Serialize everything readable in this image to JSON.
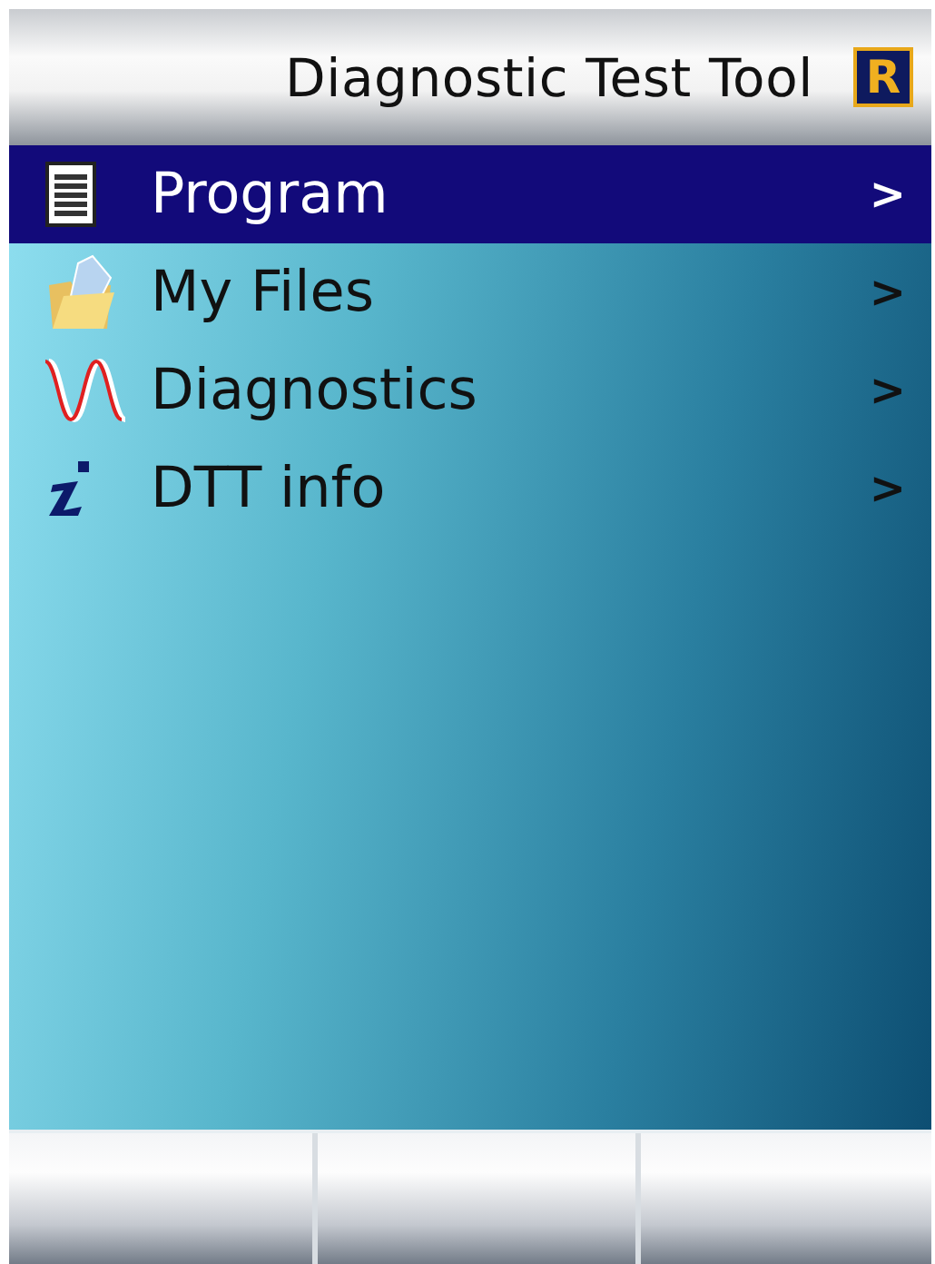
{
  "header": {
    "title": "Diagnostic Test Tool",
    "logo": "R"
  },
  "menu": [
    {
      "kind": "document",
      "label": "Program",
      "arrow": ">",
      "selected": true
    },
    {
      "kind": "folder",
      "label": "My Files",
      "arrow": ">",
      "selected": false
    },
    {
      "kind": "wave",
      "label": "Diagnostics",
      "arrow": ">",
      "selected": false
    },
    {
      "kind": "info",
      "label": "DTT info",
      "arrow": ">",
      "selected": false
    }
  ]
}
